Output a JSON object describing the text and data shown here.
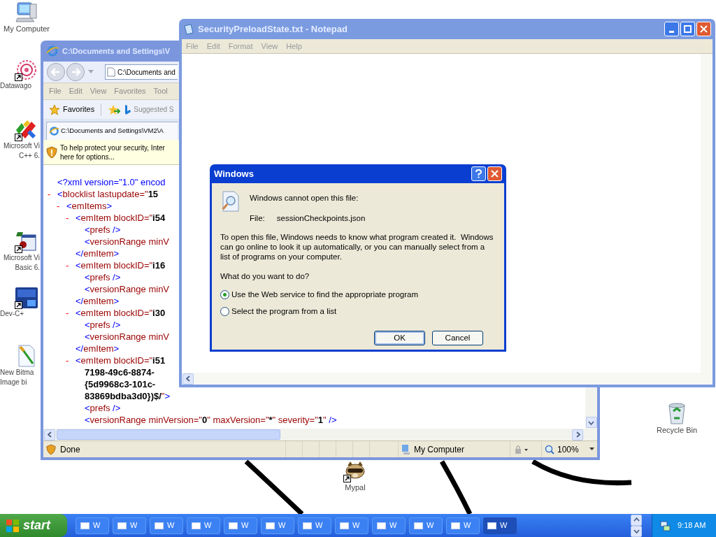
{
  "desktop_icons": [
    {
      "kind": "computer",
      "shortcut": false,
      "lines": [
        "My Computer"
      ]
    },
    {
      "kind": "flower",
      "shortcut": true,
      "lines": [
        "Datawago"
      ]
    },
    {
      "kind": "arrows",
      "shortcut": true,
      "lines": [
        "Microsoft Vi",
        "C++ 6."
      ]
    },
    {
      "kind": "vb",
      "shortcut": true,
      "lines": [
        "Microsoft Vi",
        "Basic 6."
      ]
    },
    {
      "kind": "dev",
      "shortcut": true,
      "lines": [
        "Dev-C+"
      ]
    },
    {
      "kind": "bitmap",
      "shortcut": false,
      "lines": [
        "New Bitma",
        "Image bi"
      ]
    },
    {
      "kind": "recycle",
      "shortcut": false,
      "lines": [
        "Recycle Bin"
      ]
    },
    {
      "kind": "raccoon",
      "shortcut": true,
      "lines": [
        "Mypal"
      ]
    }
  ],
  "ie_window": {
    "title": "C:\\Documents and Settings\\V",
    "address": "C:\\Documents and",
    "menu": [
      "File",
      "Edit",
      "View",
      "Favorites",
      "Tool"
    ],
    "favorites": "Favorites",
    "suggested": "Suggested S",
    "tab": "C:\\Documents and Settings\\VM2\\A",
    "info_bar": [
      "To help protect your security, Inter",
      "here for options..."
    ],
    "xml": [
      {
        "segments": [
          {
            "kind": "mark",
            "text": "<?xml version=\"1.0\" encod"
          }
        ]
      },
      {
        "toggle": "-",
        "segments": [
          {
            "kind": "mark",
            "text": "<"
          },
          {
            "kind": "name",
            "text": "blocklist lastupdate=\""
          },
          {
            "kind": "value",
            "text": "15"
          }
        ],
        "children": [
          {
            "toggle": "-",
            "segments": [
              {
                "kind": "mark",
                "text": "<"
              },
              {
                "kind": "name",
                "text": "emItems"
              },
              {
                "kind": "mark",
                "text": ">"
              }
            ],
            "children": [
              {
                "toggle": "-",
                "segments": [
                  {
                    "kind": "mark",
                    "text": "<"
                  },
                  {
                    "kind": "name",
                    "text": "emItem blockID=\""
                  },
                  {
                    "kind": "value",
                    "text": "i54"
                  }
                ],
                "children": [
                  {
                    "segments": [
                      {
                        "kind": "mark",
                        "text": "<"
                      },
                      {
                        "kind": "name",
                        "text": "prefs"
                      },
                      {
                        "kind": "mark",
                        "text": " />"
                      }
                    ]
                  },
                  {
                    "segments": [
                      {
                        "kind": "mark",
                        "text": "<"
                      },
                      {
                        "kind": "name",
                        "text": "versionRange minV"
                      }
                    ]
                  }
                ],
                "closing": [
                  {
                    "kind": "mark",
                    "text": "</"
                  },
                  {
                    "kind": "name",
                    "text": "emItem"
                  },
                  {
                    "kind": "mark",
                    "text": ">"
                  }
                ]
              },
              {
                "toggle": "-",
                "segments": [
                  {
                    "kind": "mark",
                    "text": "<"
                  },
                  {
                    "kind": "name",
                    "text": "emItem blockID=\""
                  },
                  {
                    "kind": "value",
                    "text": "i16"
                  }
                ],
                "children": [
                  {
                    "segments": [
                      {
                        "kind": "mark",
                        "text": "<"
                      },
                      {
                        "kind": "name",
                        "text": "prefs"
                      },
                      {
                        "kind": "mark",
                        "text": " />"
                      }
                    ]
                  },
                  {
                    "segments": [
                      {
                        "kind": "mark",
                        "text": "<"
                      },
                      {
                        "kind": "name",
                        "text": "versionRange minV"
                      }
                    ]
                  }
                ],
                "closing": [
                  {
                    "kind": "mark",
                    "text": "</"
                  },
                  {
                    "kind": "name",
                    "text": "emItem"
                  },
                  {
                    "kind": "mark",
                    "text": ">"
                  }
                ]
              },
              {
                "toggle": "-",
                "segments": [
                  {
                    "kind": "mark",
                    "text": "<"
                  },
                  {
                    "kind": "name",
                    "text": "emItem blockID=\""
                  },
                  {
                    "kind": "value",
                    "text": "i30"
                  }
                ],
                "children": [
                  {
                    "segments": [
                      {
                        "kind": "mark",
                        "text": "<"
                      },
                      {
                        "kind": "name",
                        "text": "prefs"
                      },
                      {
                        "kind": "mark",
                        "text": " />"
                      }
                    ]
                  },
                  {
                    "segments": [
                      {
                        "kind": "mark",
                        "text": "<"
                      },
                      {
                        "kind": "name",
                        "text": "versionRange minV"
                      }
                    ]
                  }
                ],
                "closing": [
                  {
                    "kind": "mark",
                    "text": "</"
                  },
                  {
                    "kind": "name",
                    "text": "emItem"
                  },
                  {
                    "kind": "mark",
                    "text": ">"
                  }
                ]
              },
              {
                "toggle": "-",
                "segments": [
                  {
                    "kind": "mark",
                    "text": "<"
                  },
                  {
                    "kind": "name",
                    "text": "emItem blockID=\""
                  },
                  {
                    "kind": "value",
                    "text": "i51"
                  }
                ],
                "continuation": [
                  [
                    {
                      "kind": "value",
                      "text": "7198-49c6-8874-"
                    }
                  ],
                  [
                    {
                      "kind": "value",
                      "text": "{5d9968c3-101c-"
                    }
                  ],
                  [
                    {
                      "kind": "value",
                      "text": "83869bdba3d0})$/"
                    },
                    {
                      "kind": "name",
                      "text": "\""
                    },
                    {
                      "kind": "mark",
                      "text": ">"
                    }
                  ]
                ],
                "children": [
                  {
                    "segments": [
                      {
                        "kind": "mark",
                        "text": "<"
                      },
                      {
                        "kind": "name",
                        "text": "prefs"
                      },
                      {
                        "kind": "mark",
                        "text": " />"
                      }
                    ]
                  },
                  {
                    "segments": [
                      {
                        "kind": "mark",
                        "text": "<"
                      },
                      {
                        "kind": "name",
                        "text": "versionRange minVersion=\""
                      },
                      {
                        "kind": "value",
                        "text": "0"
                      },
                      {
                        "kind": "name",
                        "text": "\" maxVersion=\""
                      },
                      {
                        "kind": "value",
                        "text": "*"
                      },
                      {
                        "kind": "name",
                        "text": "\" severity=\""
                      },
                      {
                        "kind": "value",
                        "text": "1"
                      },
                      {
                        "kind": "name",
                        "text": "\""
                      },
                      {
                        "kind": "mark",
                        "text": " />"
                      }
                    ]
                  }
                ]
              }
            ]
          }
        ]
      }
    ],
    "status": "Done",
    "zone": "My Computer",
    "zoom": "100%"
  },
  "notepad": {
    "title": "SecurityPreloadState.txt - Notepad",
    "menu": [
      "File",
      "Edit",
      "Format",
      "View",
      "Help"
    ]
  },
  "dialog": {
    "title": "Windows",
    "message": "Windows cannot open this file:",
    "file_label": "File:",
    "file_name": "sessionCheckpoints.json",
    "description": "To open this file, Windows needs to know what program created it.  Windows can go online to look it up automatically, or you can manually select from a list of programs on your computer.",
    "question": "What do you want to do?",
    "options": [
      {
        "label": "Use the Web service to find the appropriate program",
        "selected": true
      },
      {
        "label": "Select the program from a list",
        "selected": false
      }
    ],
    "buttons": [
      {
        "label": "OK",
        "default": true
      },
      {
        "label": "Cancel",
        "default": false
      }
    ]
  },
  "taskbar": {
    "start": "start",
    "tasks": [
      {
        "label": "W",
        "selected": false
      },
      {
        "label": "W",
        "selected": false
      },
      {
        "label": "W",
        "selected": false
      },
      {
        "label": "W",
        "selected": false
      },
      {
        "label": "W",
        "selected": false
      },
      {
        "label": "W",
        "selected": false
      },
      {
        "label": "W",
        "selected": false
      },
      {
        "label": "W",
        "selected": false
      },
      {
        "label": "W",
        "selected": false
      },
      {
        "label": "W",
        "selected": false
      },
      {
        "label": "W",
        "selected": false
      },
      {
        "label": "W",
        "selected": true
      }
    ],
    "clock": "9:18 AM"
  }
}
